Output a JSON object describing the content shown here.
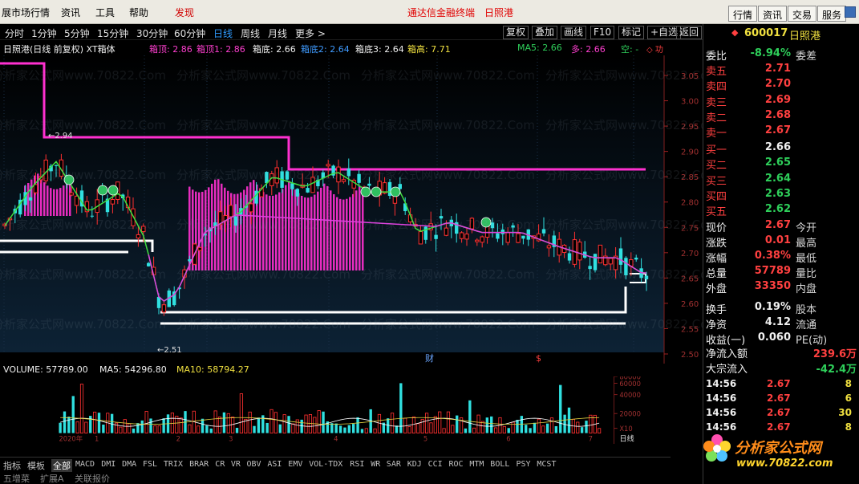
{
  "menubar": {
    "items": [
      "展市场行情",
      "资讯",
      "工具",
      "帮助",
      "发现"
    ],
    "center_left": "通达信金融终端",
    "center_right": "日照港",
    "right_buttons": [
      "行情",
      "资讯",
      "交易",
      "服务"
    ]
  },
  "toolbar": {
    "periods": [
      "分时",
      "1分钟",
      "5分钟",
      "15分钟",
      "30分钟",
      "60分钟",
      "日线",
      "周线",
      "月线",
      "更多 >"
    ],
    "active_period": "日线",
    "actions": [
      "复权",
      "叠加",
      "画线",
      "F10",
      "标记",
      "+自选",
      "返回"
    ]
  },
  "chart_info": {
    "title": "日照港(日线 前复权) XT箱体",
    "box_top": "箱顶: 2.86",
    "box_top1": "箱顶1: 2.86",
    "box_bottom": "箱底: 2.66",
    "box_bottom2": "箱底2: 2.64",
    "box_bottom3": "箱底3: 2.64",
    "box_high": "箱高: 7.71",
    "ma5": "MA5: 2.66",
    "duo": "多: 2.66",
    "kong": "空: -"
  },
  "main_chart": {
    "y_ticks": [
      "3.05",
      "3.00",
      "2.95",
      "2.90",
      "2.85",
      "2.80",
      "2.75",
      "2.70",
      "2.65",
      "2.60",
      "2.55",
      "2.50"
    ],
    "annotations": [
      "2.94",
      "2.51"
    ],
    "markers": [
      "财",
      "$"
    ],
    "colors": {
      "up": "#ff3030",
      "down": "#30e0e0",
      "box": "#ff30d0",
      "ma": "#40e040",
      "base": "#ffffff"
    }
  },
  "volume_info": {
    "volume": "VOLUME: 57789.00",
    "ma5": "MA5: 54296.80",
    "ma10": "MA10: 58794.27"
  },
  "volume_chart": {
    "y_ticks": [
      "80000",
      "60000",
      "40000",
      "20000",
      "X10"
    ],
    "x_labels": [
      "2020年",
      "1",
      "2",
      "3",
      "4",
      "5",
      "6",
      "7"
    ],
    "period_label": "日线"
  },
  "indicator_tabs": [
    "指标",
    "模板",
    "全部",
    "MACD",
    "DMI",
    "DMA",
    "FSL",
    "TRIX",
    "BRAR",
    "CR",
    "VR",
    "OBV",
    "ASI",
    "EMV",
    "VOL-TDX",
    "RSI",
    "WR",
    "SAR",
    "KDJ",
    "CCI",
    "ROC",
    "MTM",
    "BOLL",
    "PSY",
    "MCST"
  ],
  "active_tab": "全部",
  "bottom_row": [
    "五增菜",
    "扩展A",
    "关联报价"
  ],
  "quote": {
    "code": "600017",
    "name": "日照港",
    "weibi_label": "委比",
    "weibi_value": "-8.94%",
    "weicha_label": "委差",
    "asks": [
      {
        "label": "卖五",
        "price": "2.71"
      },
      {
        "label": "卖四",
        "price": "2.70"
      },
      {
        "label": "卖三",
        "price": "2.69"
      },
      {
        "label": "卖二",
        "price": "2.68"
      },
      {
        "label": "卖一",
        "price": "2.67"
      }
    ],
    "bids": [
      {
        "label": "买一",
        "price": "2.66"
      },
      {
        "label": "买二",
        "price": "2.65"
      },
      {
        "label": "买三",
        "price": "2.64"
      },
      {
        "label": "买四",
        "price": "2.63"
      },
      {
        "label": "买五",
        "price": "2.62"
      }
    ],
    "stats": [
      {
        "label": "现价",
        "value": "2.67",
        "label2": "今开"
      },
      {
        "label": "涨跌",
        "value": "0.01",
        "label2": "最高"
      },
      {
        "label": "涨幅",
        "value": "0.38%",
        "label2": "最低"
      },
      {
        "label": "总量",
        "value": "57789",
        "label2": "量比"
      },
      {
        "label": "外盘",
        "value": "33350",
        "label2": "内盘"
      },
      {
        "label": "换手",
        "value": "0.19%",
        "label2": "股本"
      },
      {
        "label": "净资",
        "value": "4.12",
        "label2": "流通"
      },
      {
        "label": "收益(一)",
        "value": "0.060",
        "label2": "PE(动)"
      }
    ],
    "flow": [
      {
        "label": "净流入额",
        "value": "239.6万"
      },
      {
        "label": "大宗流入",
        "value": "-42.4万"
      }
    ],
    "trades": [
      {
        "time": "14:56",
        "price": "2.67",
        "vol": "8"
      },
      {
        "time": "14:56",
        "price": "2.67",
        "vol": "6"
      },
      {
        "time": "14:56",
        "price": "2.67",
        "vol": "30"
      },
      {
        "time": "14:56",
        "price": "2.67",
        "vol": "8"
      }
    ]
  },
  "logo": {
    "title": "分析家公式网",
    "url": "www.70822.com"
  },
  "watermark": "分析家公式网www.70822.Com"
}
